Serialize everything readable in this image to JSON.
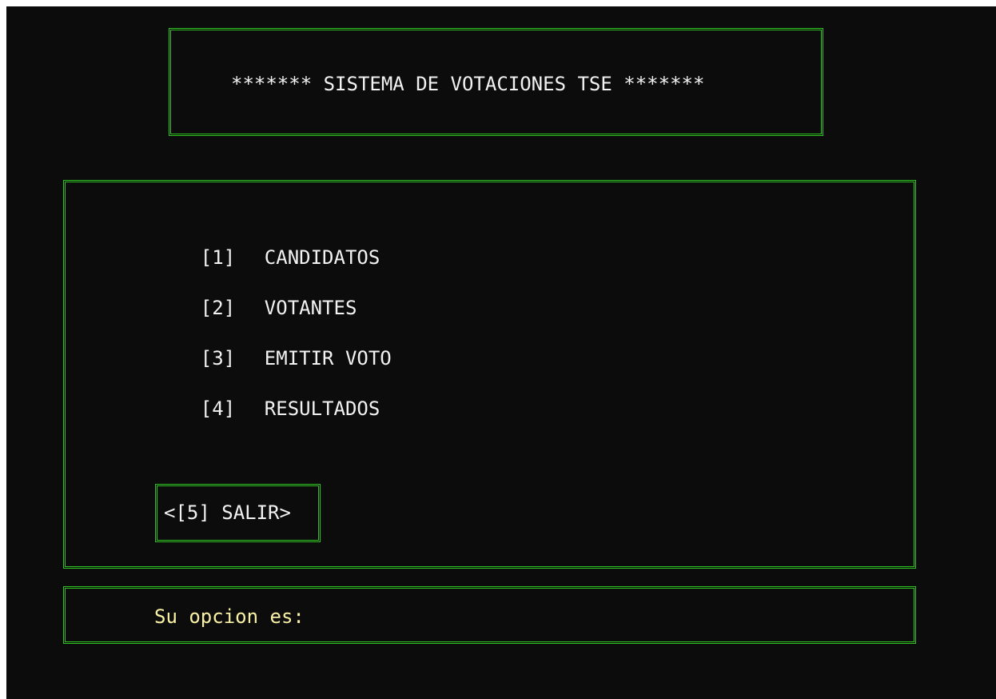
{
  "title": "******* SISTEMA DE VOTACIONES TSE *******",
  "menu": {
    "items": [
      {
        "key": "[1]",
        "label": "CANDIDATOS"
      },
      {
        "key": "[2]",
        "label": "VOTANTES"
      },
      {
        "key": "[3]",
        "label": "EMITIR VOTO"
      },
      {
        "key": "[4]",
        "label": "RESULTADOS"
      }
    ],
    "exit_label": "<[5] SALIR>"
  },
  "prompt": {
    "label": "Su opcion es:",
    "input_value": ""
  },
  "colors": {
    "background": "#0c0c0c",
    "border": "#2fc222",
    "text": "#f2f2f2",
    "prompt": "#f9f1a5"
  }
}
